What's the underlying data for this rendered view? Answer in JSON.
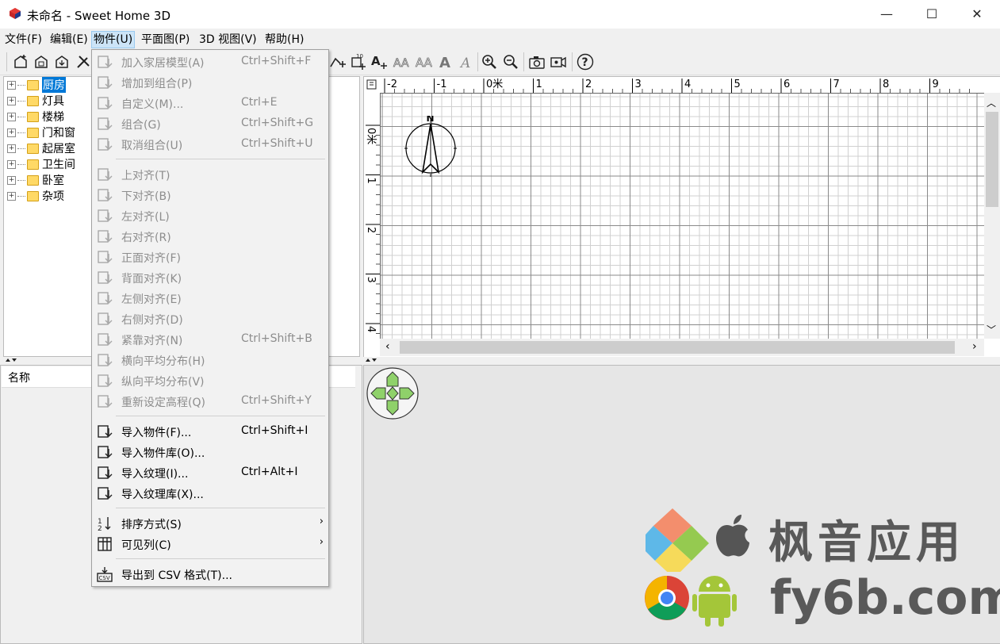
{
  "window": {
    "title": "未命名 - Sweet Home 3D",
    "minimize": "—",
    "maximize": "☐",
    "close": "✕"
  },
  "menubar": [
    "文件(F)",
    "编辑(E)",
    "物件(U)",
    "平面图(P)",
    "3D 视图(V)",
    "帮助(H)"
  ],
  "catalog": {
    "categories": [
      "厨房",
      "灯具",
      "楼梯",
      "门和窗",
      "起居室",
      "卫生间",
      "卧室",
      "杂项"
    ],
    "selected": "厨房"
  },
  "furniture_list": {
    "column_name": "名称"
  },
  "plan": {
    "ruler_top": [
      "-2",
      "-1",
      "0米",
      "1",
      "2",
      "3",
      "4",
      "5",
      "6",
      "7",
      "8",
      "9"
    ],
    "ruler_left": [
      "0米",
      "1",
      "2",
      "3",
      "4"
    ],
    "compass_label": "N"
  },
  "furniture_menu": {
    "items": [
      {
        "label": "加入家居模型(A)",
        "shortcut": "Ctrl+Shift+F",
        "icon": "add-furniture-icon",
        "enabled": false
      },
      {
        "label": "增加到组合(P)",
        "shortcut": "",
        "icon": "add-to-group-icon",
        "enabled": false
      },
      {
        "label": "自定义(M)...",
        "shortcut": "Ctrl+E",
        "icon": "modify-icon",
        "enabled": false
      },
      {
        "label": "组合(G)",
        "shortcut": "Ctrl+Shift+G",
        "icon": "group-icon",
        "enabled": false
      },
      {
        "label": "取消组合(U)",
        "shortcut": "Ctrl+Shift+U",
        "icon": "ungroup-icon",
        "enabled": false
      },
      {
        "label": "上对齐(T)",
        "shortcut": "",
        "icon": "align-top-icon",
        "enabled": false
      },
      {
        "label": "下对齐(B)",
        "shortcut": "",
        "icon": "align-bottom-icon",
        "enabled": false
      },
      {
        "label": "左对齐(L)",
        "shortcut": "",
        "icon": "align-left-icon",
        "enabled": false
      },
      {
        "label": "右对齐(R)",
        "shortcut": "",
        "icon": "align-right-icon",
        "enabled": false
      },
      {
        "label": "正面对齐(F)",
        "shortcut": "",
        "icon": "align-front-icon",
        "enabled": false
      },
      {
        "label": "背面对齐(K)",
        "shortcut": "",
        "icon": "align-back-icon",
        "enabled": false
      },
      {
        "label": "左侧对齐(E)",
        "shortcut": "",
        "icon": "align-left-side-icon",
        "enabled": false
      },
      {
        "label": "右侧对齐(D)",
        "shortcut": "",
        "icon": "align-right-side-icon",
        "enabled": false
      },
      {
        "label": "紧靠对齐(N)",
        "shortcut": "Ctrl+Shift+B",
        "icon": "align-side-by-side-icon",
        "enabled": false
      },
      {
        "label": "横向平均分布(H)",
        "shortcut": "",
        "icon": "distribute-horizontal-icon",
        "enabled": false
      },
      {
        "label": "纵向平均分布(V)",
        "shortcut": "",
        "icon": "distribute-vertical-icon",
        "enabled": false
      },
      {
        "label": "重新设定高程(Q)",
        "shortcut": "Ctrl+Shift+Y",
        "icon": "reset-elevation-icon",
        "enabled": false
      },
      {
        "label": "导入物件(F)...",
        "shortcut": "Ctrl+Shift+I",
        "icon": "import-furniture-icon",
        "enabled": true
      },
      {
        "label": "导入物件库(O)...",
        "shortcut": "",
        "icon": "import-library-icon",
        "enabled": true
      },
      {
        "label": "导入纹理(I)...",
        "shortcut": "Ctrl+Alt+I",
        "icon": "import-texture-icon",
        "enabled": true
      },
      {
        "label": "导入纹理库(X)...",
        "shortcut": "",
        "icon": "import-texture-library-icon",
        "enabled": true
      },
      {
        "label": "排序方式(S)",
        "shortcut": "",
        "icon": "sort-icon",
        "enabled": true,
        "submenu": true
      },
      {
        "label": "可见列(C)",
        "shortcut": "",
        "icon": "columns-icon",
        "enabled": true,
        "submenu": true
      },
      {
        "label": "导出到 CSV 格式(T)...",
        "shortcut": "",
        "icon": "csv-icon",
        "enabled": true
      }
    ],
    "submenu_arrow": "›",
    "separators_after": [
      4,
      16,
      20,
      22
    ]
  },
  "watermark": {
    "line1": "枫音应用",
    "line2": "fy6b.com"
  }
}
